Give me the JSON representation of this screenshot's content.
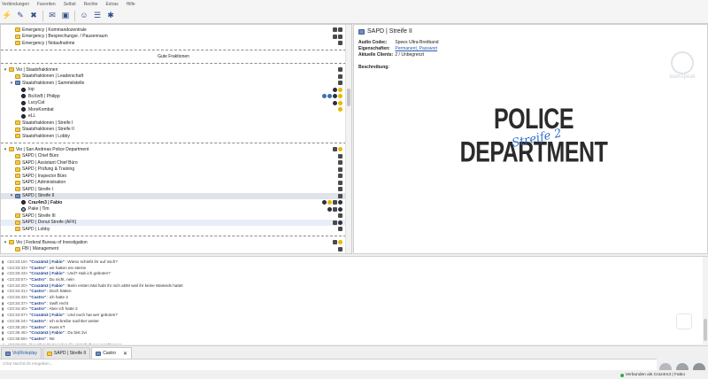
{
  "menu": [
    "Verbindungen",
    "Favoriten",
    "Selbst",
    "Rechte",
    "Extras",
    "Hilfe"
  ],
  "toolbar_icons": [
    "connect-icon",
    "pen-icon",
    "disconnect-icon",
    "chat-icon",
    "speech-icon",
    "users-icon",
    "settings-icon"
  ],
  "tree": {
    "rows": [
      {
        "kind": "channel",
        "indent": 1,
        "label": "Emergency | Kommandozentrale",
        "badges": [
          "lock",
          "lock"
        ]
      },
      {
        "kind": "channel",
        "indent": 1,
        "label": "Emergency | Besprechungsr. / Pausenraum",
        "badges": [
          "lock",
          "lock"
        ]
      },
      {
        "kind": "channel",
        "indent": 1,
        "label": "Emergency | Notaufnahme",
        "badges": [
          "lock"
        ]
      },
      {
        "kind": "spacer"
      },
      {
        "kind": "center",
        "label": "Gute Fraktionen"
      },
      {
        "kind": "spacer"
      },
      {
        "kind": "channel",
        "indent": 0,
        "arrow": "v",
        "label": "Vio | Staatsfraktionen",
        "badges": [
          "lock"
        ]
      },
      {
        "kind": "channel",
        "indent": 1,
        "label": "Staatsfraktionen | Leaderschaft",
        "badges": [
          "lock"
        ]
      },
      {
        "kind": "channel",
        "indent": 1,
        "arrow": "v",
        "label": "Staatsfraktionen | Sammelstelle",
        "badges": [
          "lock"
        ],
        "blue": true
      },
      {
        "kind": "user",
        "indent": 2,
        "label": "lop",
        "badges": [
          "dark",
          "yellow"
        ]
      },
      {
        "kind": "user",
        "indent": 2,
        "label": "BoXinB | Philipp",
        "badges": [
          "blue",
          "blue",
          "dark",
          "yellow"
        ]
      },
      {
        "kind": "user",
        "indent": 2,
        "label": "LucyCat",
        "badges": [
          "dark",
          "yellow"
        ]
      },
      {
        "kind": "user",
        "indent": 2,
        "label": "MoreKombat",
        "badges": [
          "yellow"
        ]
      },
      {
        "kind": "user",
        "indent": 2,
        "label": "eLL",
        "badges": []
      },
      {
        "kind": "channel",
        "indent": 1,
        "label": "Staatsfraktionen | Streife I",
        "badges": []
      },
      {
        "kind": "channel",
        "indent": 1,
        "label": "Staatsfraktionen | Streife II",
        "badges": []
      },
      {
        "kind": "channel",
        "indent": 1,
        "label": "Staatsfraktionen | Lobby",
        "badges": []
      },
      {
        "kind": "spacer"
      },
      {
        "kind": "channel",
        "indent": 0,
        "arrow": "v",
        "label": "Vio | San Andreas Police Department",
        "badges": [
          "lock",
          "yellow"
        ]
      },
      {
        "kind": "channel",
        "indent": 1,
        "label": "SAPD | Chief Büro",
        "badges": [
          "lock"
        ]
      },
      {
        "kind": "channel",
        "indent": 1,
        "label": "SAPD | Assistant Chief Büro",
        "badges": [
          "lock"
        ]
      },
      {
        "kind": "channel",
        "indent": 1,
        "label": "SAPD | Prüfung & Training",
        "badges": [
          "lock"
        ]
      },
      {
        "kind": "channel",
        "indent": 1,
        "label": "SAPD | Inspector Büro",
        "badges": [
          "lock"
        ]
      },
      {
        "kind": "channel",
        "indent": 1,
        "label": "SAPD | Administration",
        "badges": [
          "lock"
        ]
      },
      {
        "kind": "channel",
        "indent": 1,
        "label": "SAPD | Streife I",
        "badges": [
          "lock"
        ]
      },
      {
        "kind": "channel",
        "indent": 1,
        "arrow": "v",
        "label": "SAPD | Streife II",
        "badges": [
          "lock"
        ],
        "selected": true,
        "blue": true
      },
      {
        "kind": "user",
        "indent": 2,
        "label": "Craz4m3 | Fabio",
        "bold": true,
        "badges": [
          "dark",
          "yellow",
          "lock",
          "dark"
        ]
      },
      {
        "kind": "user",
        "indent": 2,
        "label": "Pake | Tim",
        "gray": true,
        "badges": [
          "dark",
          "lock",
          "dark"
        ]
      },
      {
        "kind": "channel",
        "indent": 1,
        "label": "SAPD | Streife III",
        "badges": [
          "lock"
        ]
      },
      {
        "kind": "channel",
        "indent": 1,
        "label": "SAPD | Donut Streife (AFK)",
        "badges": [
          "lock",
          "dark"
        ],
        "highlight": true
      },
      {
        "kind": "channel",
        "indent": 1,
        "label": "SAPD | Lobby",
        "badges": [
          "lock"
        ]
      },
      {
        "kind": "spacer"
      },
      {
        "kind": "channel",
        "indent": 0,
        "arrow": "v",
        "label": "Vio | Federal Bureau of Investigation",
        "badges": [
          "lock",
          "yellow"
        ]
      },
      {
        "kind": "channel",
        "indent": 1,
        "label": "FBI | Management",
        "badges": [
          "lock"
        ]
      }
    ]
  },
  "info": {
    "title": "SAPD | Streife II",
    "fields": [
      {
        "key": "Audio Codec:",
        "value": "Speex Ultra-Breitband",
        "link": false
      },
      {
        "key": "Eigenschaften:",
        "value": "Permanent, Passwort",
        "link": true
      },
      {
        "key": "Aktuelle Clients:",
        "value": "2 / Unbegrenzt",
        "link": false
      }
    ],
    "description_label": "Beschreibung:",
    "banner_main": "POLICE DEPARTMENT",
    "banner_sub": "Streife 2",
    "watermark": "teamspeak"
  },
  "chat": {
    "lines": [
      {
        "ts": "<23:33:19>",
        "name": "\"Craz4m3 | Fabio\"",
        "text": ": Wieso schießt ihr auf mich?"
      },
      {
        "ts": "<23:33:33>",
        "name": "\"Castro\"",
        "text": ": wir hatten ein sterne"
      },
      {
        "ts": "<23:33:43>",
        "name": "\"Craz4m3 | Fabio\"",
        "text": ": Und? Hab ich geboten?"
      },
      {
        "ts": "<23:33:57>",
        "name": "\"Castro\"",
        "text": ": Du nicht, nein"
      },
      {
        "ts": "<23:34:20>",
        "name": "\"Craz4m3 | Fabio\"",
        "text": ": Beim ersten Mal habt ihr nich aDM weil ihr keine Wanteds hattet"
      },
      {
        "ts": "<23:34:31>",
        "name": "\"Castro\"",
        "text": ": Doch hätten"
      },
      {
        "ts": "<23:34:33>",
        "name": "\"Castro\"",
        "text": ": ich hatte 2"
      },
      {
        "ts": "<23:34:37>",
        "name": "\"Castro\"",
        "text": ": Swift recht"
      },
      {
        "ts": "<23:34:40>",
        "name": "\"Castro\"",
        "text": ": Aber ich hatte 2"
      },
      {
        "ts": "<23:34:57>",
        "name": "\"Craz4m3 | Fabio\"",
        "text": ": Und euch hat wer geboten?"
      },
      {
        "ts": "<23:35:24>",
        "name": "\"Castro\"",
        "text": ": Ich schreibe nachher weiter"
      },
      {
        "ts": "<23:35:26>",
        "name": "\"Castro\"",
        "text": ": muss IrT"
      },
      {
        "ts": "<23:35:46>",
        "name": "\"Craz4m3 | Fabio\"",
        "text": ": Du bist 2vi"
      },
      {
        "ts": "<23:35:59>",
        "name": "\"Castro\"",
        "text": ": Nö"
      },
      {
        "ts": "<23:36:03>",
        "name": "",
        "text": "Der Chat-Partner hat die Unterhaltung geschlossen"
      }
    ]
  },
  "tabs": [
    {
      "label": "Vio|Roleplay",
      "icon": "server-icon",
      "active": false
    },
    {
      "label": "SAPD | Streife II",
      "icon": "channel-icon",
      "active": false
    },
    {
      "label": "Castro",
      "icon": "user-icon",
      "active": true,
      "closable": true
    }
  ],
  "input_placeholder": "Chat Nachricht eingeben...",
  "status": {
    "connection": "Verbunden als Craz4m3 | Fabio"
  }
}
